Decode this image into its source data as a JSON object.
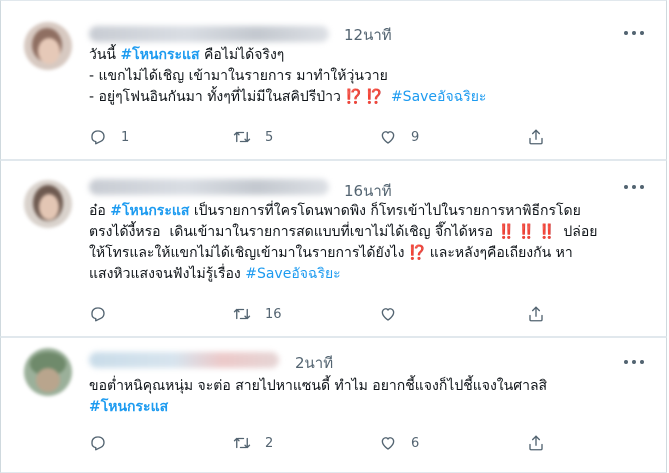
{
  "tweets": [
    {
      "time": "12นาที",
      "lines": [
        {
          "parts": [
            {
              "t": "วันนี้ ",
              "k": "text"
            },
            {
              "t": "#โหนกระแส",
              "k": "tag"
            },
            {
              "t": " คือไม่ได้จริงๆ",
              "k": "text"
            }
          ]
        },
        {
          "parts": [
            {
              "t": "- แขกไม่ได้เชิญ เข้ามาในรายการ มาทำให้วุ่นวาย",
              "k": "text"
            }
          ]
        },
        {
          "parts": [
            {
              "t": "- อยู่ๆโฟนอินกันมา ทั้งๆที่ไม่มีในสคิปรีป่าว ",
              "k": "text"
            },
            {
              "t": "⁉️ ⁉️",
              "k": "bang"
            },
            {
              "t": "  ",
              "k": "text"
            },
            {
              "t": "#Saveอัจฉริยะ",
              "k": "tagl"
            }
          ]
        }
      ],
      "replies": "1",
      "retweets": "5",
      "likes": "9"
    },
    {
      "time": "16นาที",
      "lines": [
        {
          "parts": [
            {
              "t": "อ๋อ ",
              "k": "text"
            },
            {
              "t": "#โหนกระแส",
              "k": "tag"
            },
            {
              "t": " เป็นรายการที่ใครโดนพาดพิง ก็โทรเข้าไปในรายการหาพิธีกรโดย",
              "k": "text"
            }
          ]
        },
        {
          "parts": [
            {
              "t": "ตรงได้งี้หรอ  เดินเข้ามาในรายการสดแบบที่เขาไม่ได้เชิญ จึ๊กได้หรอ ",
              "k": "text"
            },
            {
              "t": "‼️ ‼️ ‼️",
              "k": "bang"
            },
            {
              "t": "  ปล่อย",
              "k": "text"
            }
          ]
        },
        {
          "parts": [
            {
              "t": "ให้โทรและให้แขกไม่ได้เชิญเข้ามาในรายการได้ยังไง ",
              "k": "text"
            },
            {
              "t": "⁉️",
              "k": "bang"
            },
            {
              "t": " และหลังๆคือเถียงกัน หา",
              "k": "text"
            }
          ]
        },
        {
          "parts": [
            {
              "t": "แสงหิวแสงจนฟังไม่รู้เรื่อง ",
              "k": "text"
            },
            {
              "t": "#Saveอัจฉริยะ",
              "k": "tagl"
            }
          ]
        }
      ],
      "replies": "",
      "retweets": "16",
      "likes": ""
    },
    {
      "time": "2นาที",
      "lines": [
        {
          "parts": [
            {
              "t": "ขอต่ำหนิคุณหนุ่ม จะต่อ สายไปหาแซนดี้ ทำไม อยากชี้แจงก็ไปชี้แจงในศาลสิ",
              "k": "text"
            }
          ]
        },
        {
          "parts": [
            {
              "t": "#โหนกระแส",
              "k": "tag"
            }
          ]
        }
      ],
      "replies": "",
      "retweets": "2",
      "likes": "6"
    }
  ]
}
